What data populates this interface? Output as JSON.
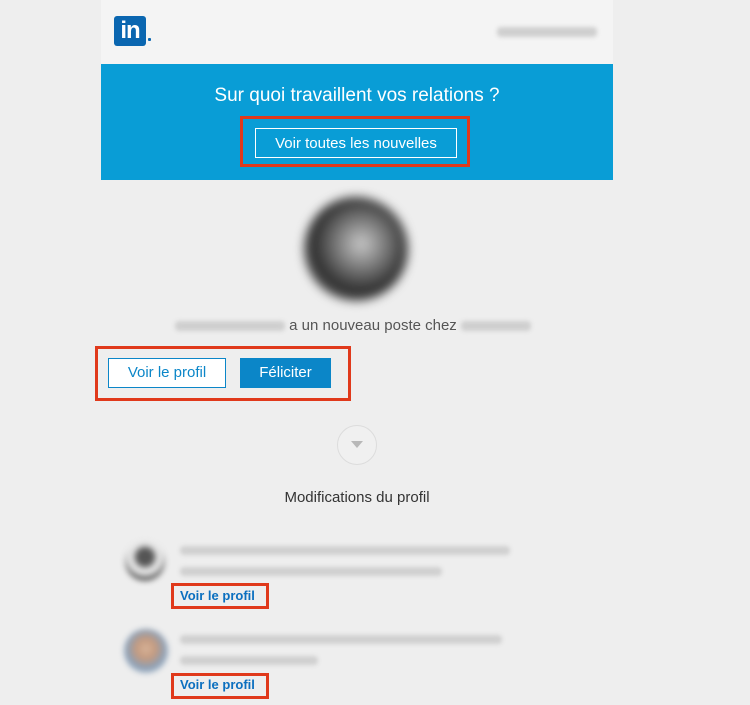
{
  "header": {
    "logo_text": "in"
  },
  "banner": {
    "title": "Sur quoi travaillent vos relations ?",
    "button_label": "Voir toutes les nouvelles"
  },
  "news": {
    "text": "a un nouveau poste chez",
    "view_profile_label": "Voir le profil",
    "congratulate_label": "Féliciter"
  },
  "profile_changes": {
    "title": "Modifications du profil",
    "items": [
      {
        "link_label": "Voir le profil"
      },
      {
        "link_label": "Voir le profil"
      }
    ]
  },
  "colors": {
    "banner": "#099dd6",
    "brand": "#0a66b0",
    "button": "#0b86c8",
    "highlight": "#e0391b"
  }
}
